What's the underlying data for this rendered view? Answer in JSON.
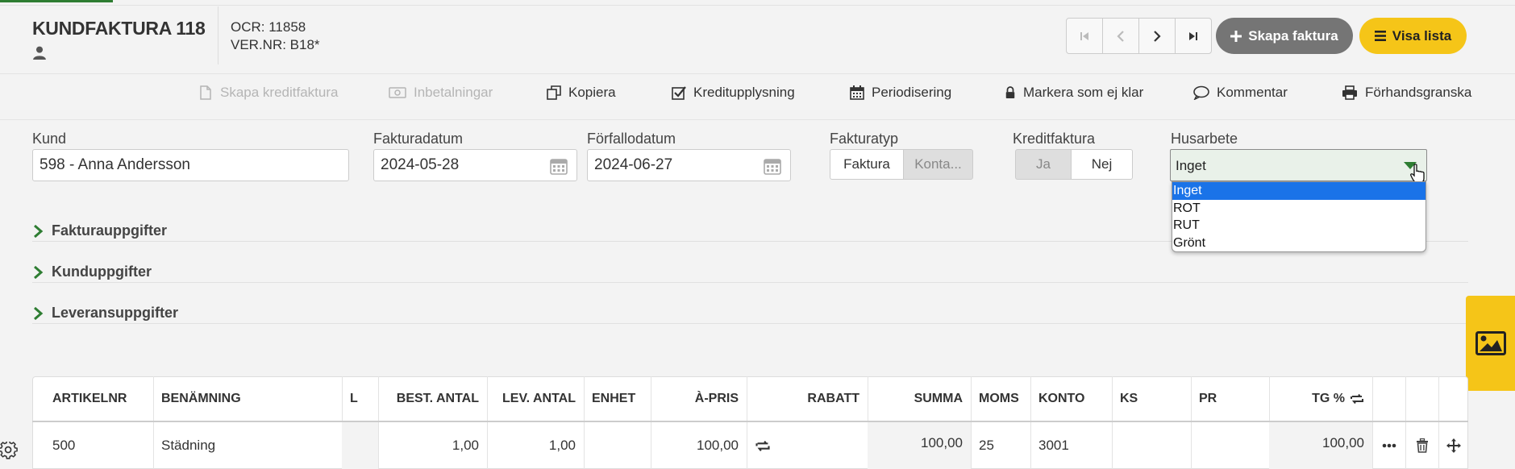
{
  "header": {
    "title": "KUNDFAKTURA 118",
    "ocr": "OCR: 11858",
    "vernr": "VER.NR: B18*",
    "skapa_label": "Skapa faktura",
    "visa_label": "Visa lista"
  },
  "toolbar": [
    {
      "label": "Skapa kreditfaktura",
      "icon": "document-icon",
      "enabled": false
    },
    {
      "label": "Inbetalningar",
      "icon": "money-icon",
      "enabled": false
    },
    {
      "label": "Kopiera",
      "icon": "copy-icon",
      "enabled": true
    },
    {
      "label": "Kreditupplysning",
      "icon": "checkbox-icon",
      "enabled": true
    },
    {
      "label": "Periodisering",
      "icon": "calendar-icon",
      "enabled": true
    },
    {
      "label": "Markera som ej klar",
      "icon": "lock-icon",
      "enabled": true
    },
    {
      "label": "Kommentar",
      "icon": "comment-icon",
      "enabled": true
    },
    {
      "label": "Förhandsgranska",
      "icon": "print-icon",
      "enabled": true
    }
  ],
  "form": {
    "kund_label": "Kund",
    "kund_value": "598 - Anna Andersson",
    "fakturadatum_label": "Fakturadatum",
    "fakturadatum_value": "2024-05-28",
    "forfallodatum_label": "Förfallodatum",
    "forfallodatum_value": "2024-06-27",
    "fakturatyp_label": "Fakturatyp",
    "fakturatyp_options": [
      "Faktura",
      "Konta..."
    ],
    "kreditfaktura_label": "Kreditfaktura",
    "kreditfaktura_options": [
      "Ja",
      "Nej"
    ],
    "husarbete_label": "Husarbete",
    "husarbete_value": "Inget",
    "husarbete_options": [
      "Inget",
      "ROT",
      "RUT",
      "Grönt"
    ]
  },
  "accordions": [
    "Fakturauppgifter",
    "Kunduppgifter",
    "Leveransuppgifter"
  ],
  "table": {
    "headers": [
      "ARTIKELNR",
      "BENÄMNING",
      "L",
      "BEST. ANTAL",
      "LEV. ANTAL",
      "ENHET",
      "À-PRIS",
      "RABATT",
      "SUMMA",
      "MOMS",
      "KONTO",
      "KS",
      "PR",
      "TG %"
    ],
    "rows": [
      {
        "artikelnr": "500",
        "benamning": "Städning",
        "l": "",
        "best_antal": "1,00",
        "lev_antal": "1,00",
        "enhet": "",
        "a_pris": "100,00",
        "rabatt": "",
        "summa": "100,00",
        "moms": "25",
        "konto": "3001",
        "ks": "",
        "pr": "",
        "tg": "100,00"
      }
    ]
  },
  "colors": {
    "accent_green": "#2e7d32",
    "brand_yellow": "#f5c518",
    "select_blue": "#1a73e8"
  }
}
